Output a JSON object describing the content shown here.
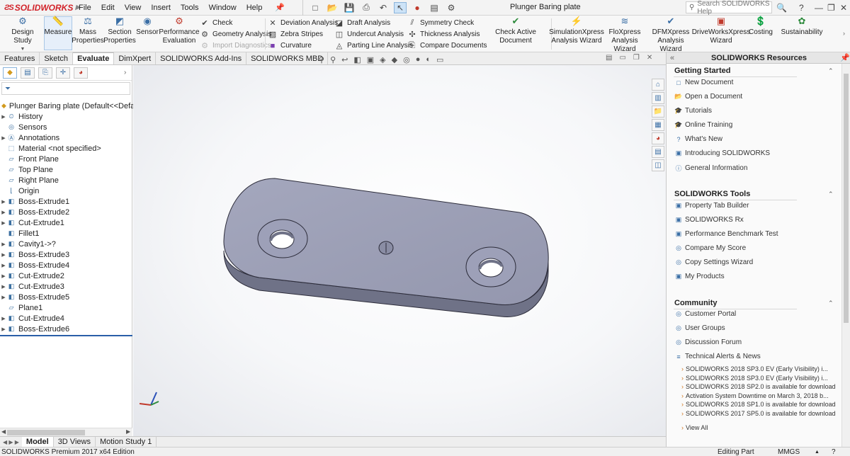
{
  "app": {
    "logo_text": "SOLIDWORKS",
    "doc_title": "Plunger Baring plate",
    "menu": [
      "File",
      "Edit",
      "View",
      "Insert",
      "Tools",
      "Window",
      "Help"
    ],
    "help_search_placeholder": "Search SOLIDWORKS Help"
  },
  "command_manager": {
    "big_buttons": [
      {
        "label": "Design Study",
        "icon": "design-study-icon"
      },
      {
        "label": "Measure",
        "icon": "measure-icon"
      },
      {
        "label": "Mass Properties",
        "icon": "mass-properties-icon"
      },
      {
        "label": "Section Properties",
        "icon": "section-properties-icon"
      },
      {
        "label": "Sensor",
        "icon": "sensor-icon"
      },
      {
        "label": "Performance Evaluation",
        "icon": "performance-evaluation-icon"
      }
    ],
    "check_group": [
      "Check",
      "Geometry Analysis",
      "Import Diagnostics"
    ],
    "deviation_group": [
      "Deviation Analysis",
      "Zebra Stripes",
      "Curvature"
    ],
    "draft_group": [
      "Draft Analysis",
      "Undercut Analysis",
      "Parting Line Analysis"
    ],
    "symmetry_group": [
      "Symmetry Check",
      "Thickness Analysis",
      "Compare Documents"
    ],
    "check_active": "Check Active Document",
    "wizards": [
      "SimulationXpress Analysis Wizard",
      "FloXpress Analysis Wizard",
      "DFMXpress Analysis Wizard",
      "DriveWorksXpress Wizard",
      "Costing",
      "Sustainability"
    ]
  },
  "tabs": [
    "Features",
    "Sketch",
    "Evaluate",
    "DimXpert",
    "SOLIDWORKS Add-Ins",
    "SOLIDWORKS MBD"
  ],
  "active_tab": "Evaluate",
  "feature_tree": {
    "root": "Plunger Baring plate  (Default<<Default>",
    "items": [
      {
        "label": "History",
        "expandable": true
      },
      {
        "label": "Sensors",
        "expandable": false
      },
      {
        "label": "Annotations",
        "expandable": true
      },
      {
        "label": "Material <not specified>",
        "expandable": false
      },
      {
        "label": "Front Plane",
        "expandable": false
      },
      {
        "label": "Top Plane",
        "expandable": false
      },
      {
        "label": "Right Plane",
        "expandable": false
      },
      {
        "label": "Origin",
        "expandable": false
      },
      {
        "label": "Boss-Extrude1",
        "expandable": true
      },
      {
        "label": "Boss-Extrude2",
        "expandable": true
      },
      {
        "label": "Cut-Extrude1",
        "expandable": true
      },
      {
        "label": "Fillet1",
        "expandable": false
      },
      {
        "label": "Cavity1->?",
        "expandable": true
      },
      {
        "label": "Boss-Extrude3",
        "expandable": true
      },
      {
        "label": "Boss-Extrude4",
        "expandable": true
      },
      {
        "label": "Cut-Extrude2",
        "expandable": true
      },
      {
        "label": "Cut-Extrude3",
        "expandable": true
      },
      {
        "label": "Boss-Extrude5",
        "expandable": true
      },
      {
        "label": "Plane1",
        "expandable": false
      },
      {
        "label": "Cut-Extrude4",
        "expandable": true
      },
      {
        "label": "Boss-Extrude6",
        "expandable": true
      }
    ]
  },
  "bottom_tabs": [
    "Model",
    "3D Views",
    "Motion Study 1"
  ],
  "status": {
    "edition": "SOLIDWORKS Premium 2017 x64 Edition",
    "mode": "Editing Part",
    "units": "MMGS"
  },
  "task_pane": {
    "title": "SOLIDWORKS Resources",
    "getting_started": {
      "title": "Getting Started",
      "items": [
        "New Document",
        "Open a Document",
        "Tutorials",
        "Online Training",
        "What's New",
        "Introducing SOLIDWORKS",
        "General Information"
      ]
    },
    "tools": {
      "title": "SOLIDWORKS Tools",
      "items": [
        "Property Tab Builder",
        "SOLIDWORKS Rx",
        "Performance Benchmark Test",
        "Compare My Score",
        "Copy Settings Wizard",
        "My Products"
      ]
    },
    "community": {
      "title": "Community",
      "items": [
        "Customer Portal",
        "User Groups",
        "Discussion Forum",
        "Technical Alerts & News"
      ]
    },
    "news": [
      "SOLIDWORKS 2018 SP3.0 EV (Early Visibility) i...",
      "SOLIDWORKS 2018 SP3.0 EV (Early Visibility) i...",
      "SOLIDWORKS 2018 SP2.0 is available for download",
      "Activation System Downtime on March 3, 2018 b...",
      "SOLIDWORKS 2018 SP1.0 is available for download",
      "SOLIDWORKS 2017 SP5.0 is available for download"
    ],
    "view_all": "View All"
  },
  "colors": {
    "part_top": "#9c9fb6",
    "part_side": "#6f7287",
    "accent": "#3a6ea5",
    "brand": "#d2232a"
  }
}
